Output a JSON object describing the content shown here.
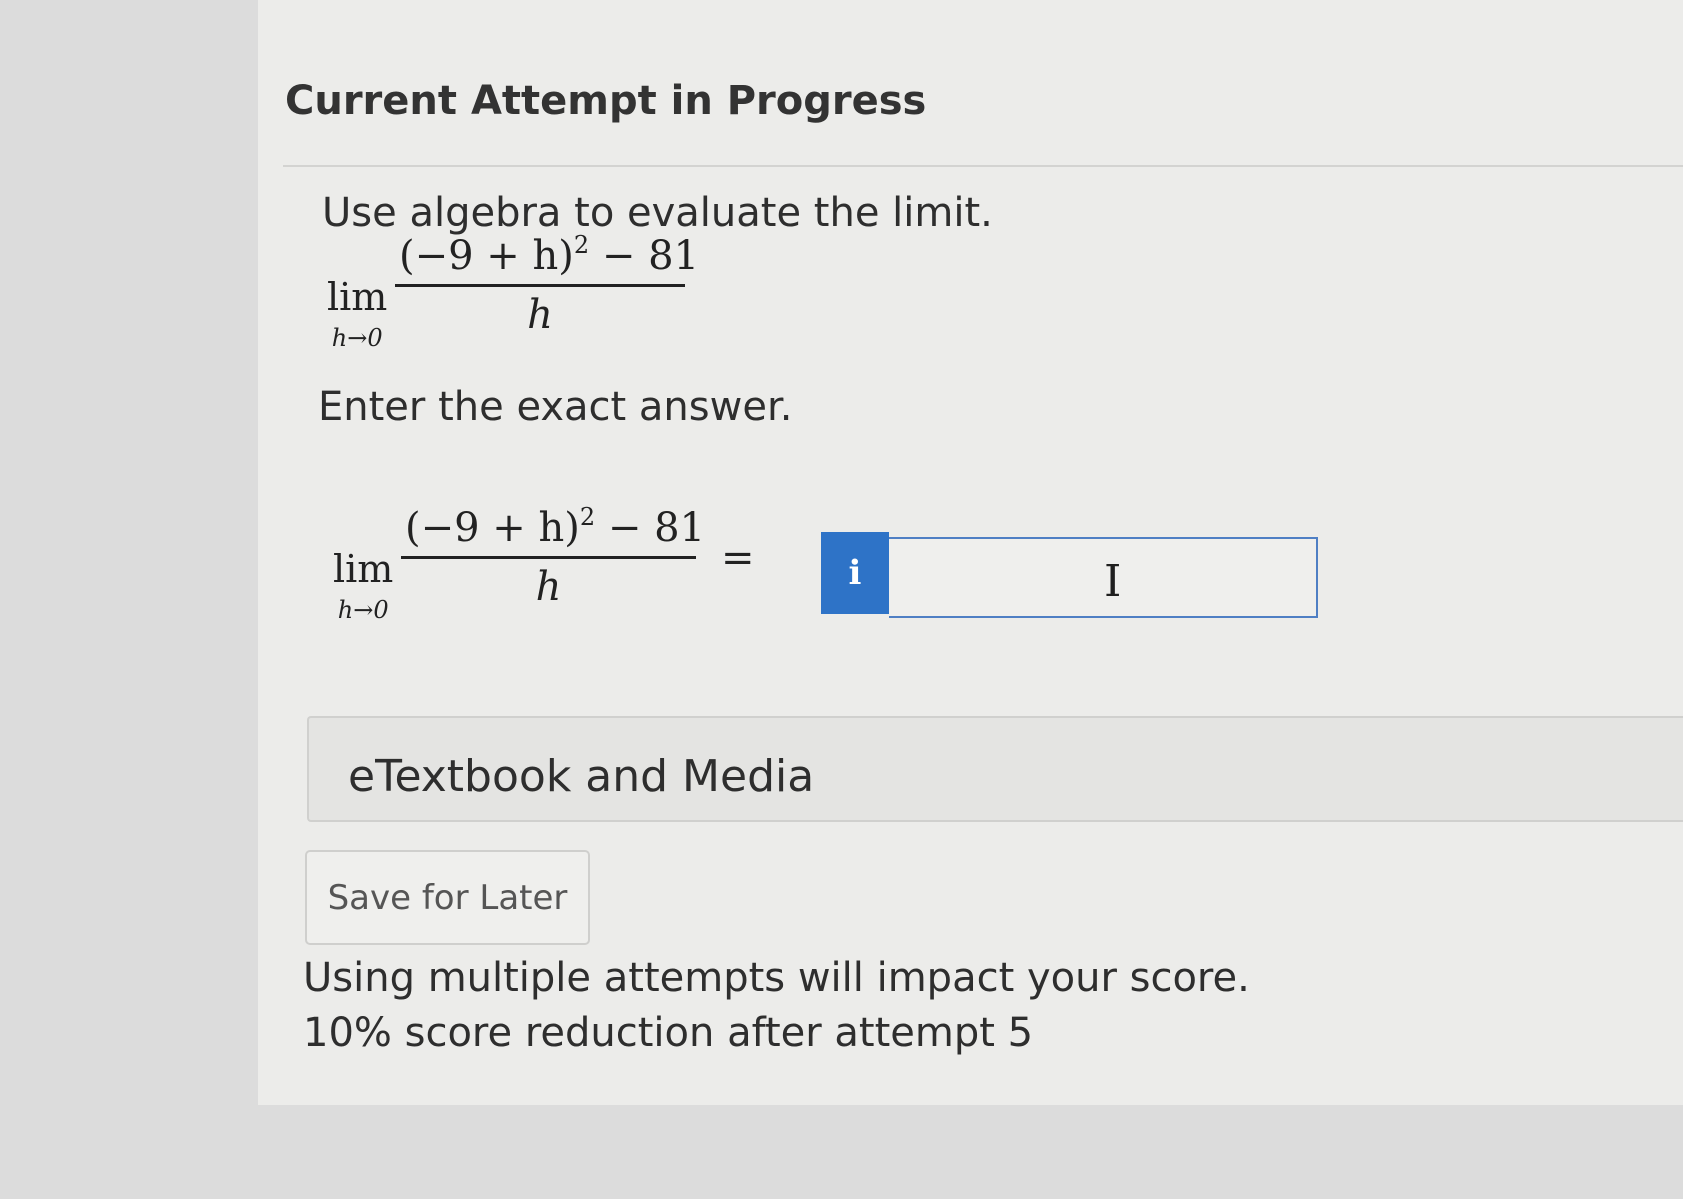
{
  "header": {
    "title": "Current Attempt in Progress"
  },
  "question": {
    "instruction": "Use algebra to evaluate the limit.",
    "limit_word": "lim",
    "limit_subscript": "h→0",
    "numerator_base": "(−9 + h)",
    "numerator_exponent": "2",
    "numerator_tail": " − 81",
    "denominator": "h",
    "answer_prompt": "Enter the exact answer.",
    "equals_sign": "="
  },
  "answer": {
    "info_button_label": "i",
    "input_value": "",
    "cursor_glyph": "I"
  },
  "etextbook": {
    "label": "eTextbook and Media"
  },
  "actions": {
    "save_label": "Save for Later"
  },
  "attempt_notice": {
    "line1": "Using multiple attempts will impact your score.",
    "line2": "10% score reduction after attempt 5"
  }
}
